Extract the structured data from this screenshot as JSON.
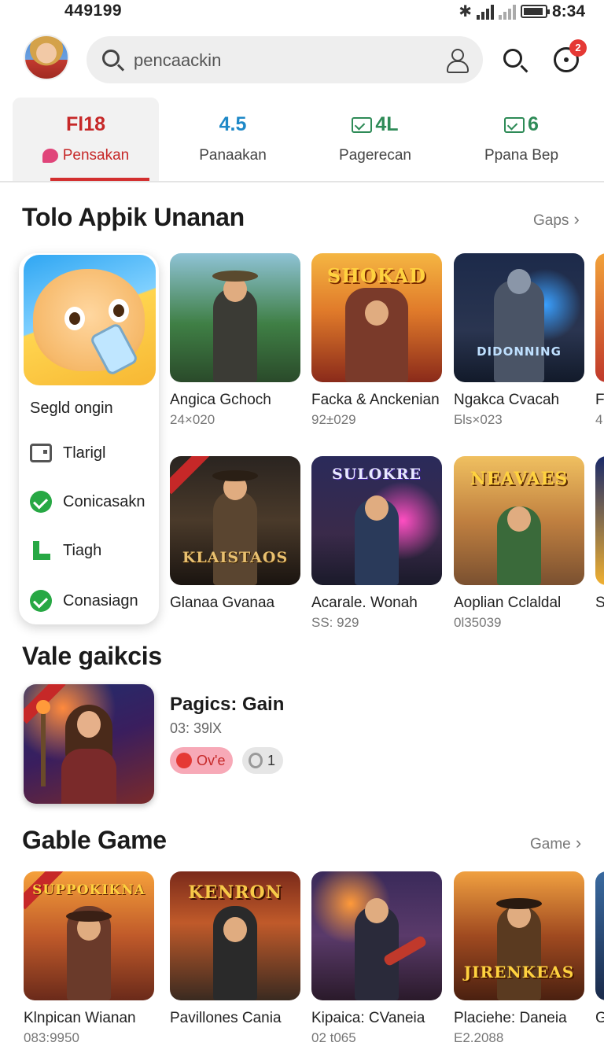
{
  "status_bar": {
    "left_text": "449199",
    "time": "8:34"
  },
  "header": {
    "search_placeholder": "pencaackin",
    "notification_count": "2"
  },
  "stats": [
    {
      "value": "Fl18",
      "label": "Pensakan",
      "value_color": "#c62828",
      "active": true
    },
    {
      "value": "4.5",
      "label": "Panaakan",
      "value_color": "#1e88c7",
      "active": false
    },
    {
      "value": "4L",
      "label": "Pagerecan",
      "value_color": "#2e8b57",
      "active": false
    },
    {
      "value": "6",
      "label": "Ppana Bep",
      "value_color": "#2e8b57",
      "active": false
    }
  ],
  "section1": {
    "title": "Tolo Apþik Unanan",
    "more": "Gaps"
  },
  "menu_card": {
    "title": "Segld ongin",
    "items": [
      {
        "label": "Tlarigl",
        "icon": "box-icon"
      },
      {
        "label": "Conicasakn",
        "icon": "check-icon"
      },
      {
        "label": "Tiagh",
        "icon": "l-icon"
      },
      {
        "label": "Conasiagn",
        "icon": "check-icon"
      }
    ]
  },
  "row1": [
    {
      "name": "Angica Gchoch",
      "meta": "24×020",
      "logo": ""
    },
    {
      "name": "Facka & Anckenian",
      "meta": "92±029",
      "logo": "SHOKAD"
    },
    {
      "name": "Ngakca Cvacah",
      "meta": "Ƃls×023",
      "logo": "DIDONNING"
    },
    {
      "name": "F",
      "meta": "4",
      "logo": ""
    }
  ],
  "row2": [
    {
      "name": "Glanaa Gvanaa",
      "meta": "",
      "logo": "KLAISTAOS"
    },
    {
      "name": "Acarale. Wonah",
      "meta": "SS: 929",
      "logo": "SULOKRE"
    },
    {
      "name": "Aoplian Cclaldal",
      "meta": "0l35039",
      "logo": "NEAVAES"
    },
    {
      "name": "S",
      "meta": "",
      "logo": ""
    }
  ],
  "section2": {
    "title": "Vale gaikcis"
  },
  "featured": {
    "title": "Pagics: Gain",
    "meta": "03: 39lX",
    "chip1": "Ov'e",
    "chip2": "1"
  },
  "section3": {
    "title": "Gable Game",
    "more": "Game"
  },
  "row3": [
    {
      "name": "Klnpican Wianan",
      "meta": "083:9950",
      "logo": "SUPPOKIKNA"
    },
    {
      "name": "Pavillones Cania",
      "meta": "",
      "logo": "KENRON"
    },
    {
      "name": "Kipaica: CVaneia",
      "meta": "02 t065",
      "logo": ""
    },
    {
      "name": "Placiehe: Daneia",
      "meta": "E2.2088",
      "logo": "JIRENKEAS"
    },
    {
      "name": "G",
      "meta": "",
      "logo": ""
    }
  ]
}
